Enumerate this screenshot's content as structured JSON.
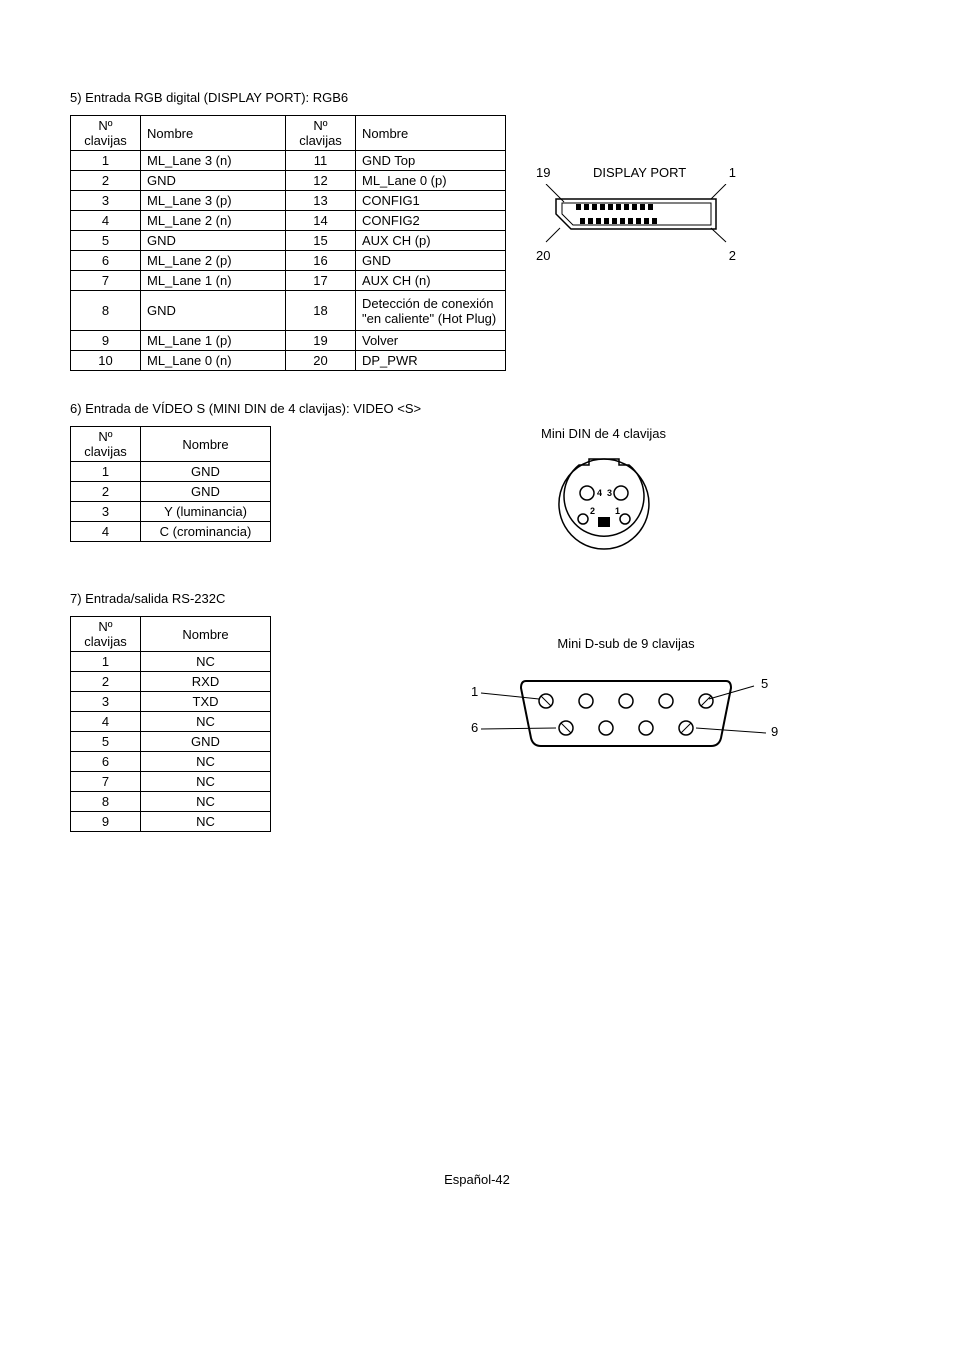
{
  "section5": {
    "title": "5)   Entrada RGB digital (DISPLAY PORT): RGB6",
    "headers": {
      "pin": "Nº clavijas",
      "name": "Nombre"
    },
    "rows": [
      {
        "p1": "1",
        "n1": "ML_Lane 3 (n)",
        "p2": "11",
        "n2": "GND Top"
      },
      {
        "p1": "2",
        "n1": "GND",
        "p2": "12",
        "n2": "ML_Lane 0 (p)"
      },
      {
        "p1": "3",
        "n1": "ML_Lane 3 (p)",
        "p2": "13",
        "n2": "CONFIG1"
      },
      {
        "p1": "4",
        "n1": "ML_Lane 2 (n)",
        "p2": "14",
        "n2": "CONFIG2"
      },
      {
        "p1": "5",
        "n1": "GND",
        "p2": "15",
        "n2": "AUX CH (p)"
      },
      {
        "p1": "6",
        "n1": "ML_Lane 2 (p)",
        "p2": "16",
        "n2": "GND"
      },
      {
        "p1": "7",
        "n1": "ML_Lane 1 (n)",
        "p2": "17",
        "n2": "AUX CH (n)"
      },
      {
        "p1": "8",
        "n1": "GND",
        "p2": "18",
        "n2": "Detección de conexión \"en caliente\" (Hot Plug)"
      },
      {
        "p1": "9",
        "n1": "ML_Lane 1 (p)",
        "p2": "19",
        "n2": "Volver"
      },
      {
        "p1": "10",
        "n1": "ML_Lane 0 (n)",
        "p2": "20",
        "n2": "DP_PWR"
      }
    ],
    "diagram": {
      "topLeft": "19",
      "topCenter": "DISPLAY PORT",
      "topRight": "1",
      "bottomLeft": "20",
      "bottomRight": "2"
    }
  },
  "section6": {
    "title": "6)   Entrada de VÍDEO S (MINI DIN de 4 clavijas):  VIDEO <S>",
    "headers": {
      "pin": "Nº clavijas",
      "name": "Nombre"
    },
    "rows": [
      {
        "p": "1",
        "n": "GND"
      },
      {
        "p": "2",
        "n": "GND"
      },
      {
        "p": "3",
        "n": "Y (luminancia)"
      },
      {
        "p": "4",
        "n": "C (crominancia)"
      }
    ],
    "diagramLabel": "Mini DIN de 4 clavijas",
    "pins": {
      "tl": "4",
      "tr": "3",
      "bl": "2",
      "br": "1"
    }
  },
  "section7": {
    "title": "7)   Entrada/salida RS-232C",
    "headers": {
      "pin": "Nº clavijas",
      "name": "Nombre"
    },
    "rows": [
      {
        "p": "1",
        "n": "NC"
      },
      {
        "p": "2",
        "n": "RXD"
      },
      {
        "p": "3",
        "n": "TXD"
      },
      {
        "p": "4",
        "n": "NC"
      },
      {
        "p": "5",
        "n": "GND"
      },
      {
        "p": "6",
        "n": "NC"
      },
      {
        "p": "7",
        "n": "NC"
      },
      {
        "p": "8",
        "n": "NC"
      },
      {
        "p": "9",
        "n": "NC"
      }
    ],
    "diagramLabel": "Mini D-sub de 9 clavijas",
    "corners": {
      "tl": "1",
      "tr": "5",
      "bl": "6",
      "br": "9"
    }
  },
  "footer": "Español-42"
}
